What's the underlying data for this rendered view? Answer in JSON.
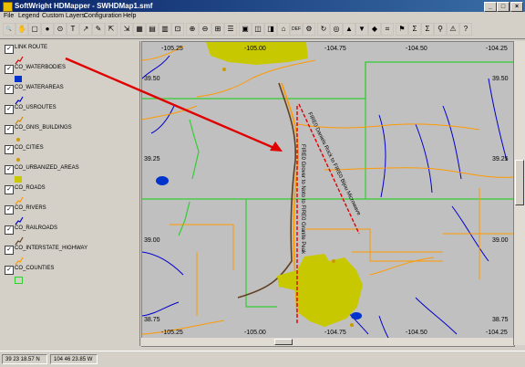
{
  "window": {
    "title": "SoftWright HDMapper - SWHDMap1.smf"
  },
  "menu": [
    "File",
    "Legend",
    "Custom Layers",
    "Configuration",
    "Help"
  ],
  "toolbar": {
    "count": 36
  },
  "legend": {
    "items": [
      {
        "label": "LINK ROUTE",
        "checked": true,
        "symbol": "line",
        "color": "#e00000"
      },
      {
        "label": "CO_WATERBODIES",
        "checked": true,
        "symbol": "fill",
        "color": "#0033cc"
      },
      {
        "label": "CO_WATERAREAS",
        "checked": true,
        "symbol": "line",
        "color": "#0000cc"
      },
      {
        "label": "CO_USROUTES",
        "checked": true,
        "symbol": "line",
        "color": "#cc8800"
      },
      {
        "label": "CO_GNIS_BUILDINGS",
        "checked": true,
        "symbol": "dot",
        "color": "#cc9900"
      },
      {
        "label": "CO_CITIES",
        "checked": true,
        "symbol": "dot",
        "color": "#cc9900"
      },
      {
        "label": "CO_URBANIZED_AREAS",
        "checked": true,
        "symbol": "fill",
        "color": "#c8c800"
      },
      {
        "label": "CO_ROADS",
        "checked": true,
        "symbol": "line",
        "color": "#ff9900"
      },
      {
        "label": "CO_RIVERS",
        "checked": true,
        "symbol": "line",
        "color": "#0000cc"
      },
      {
        "label": "CO_RAILROADS",
        "checked": true,
        "symbol": "line",
        "color": "#604020"
      },
      {
        "label": "CO_INTERSTATE_HIGHWAY",
        "checked": true,
        "symbol": "line",
        "color": "#ff9900"
      },
      {
        "label": "CO_COUNTIES",
        "checked": true,
        "symbol": "box",
        "color": "#33cc33"
      }
    ]
  },
  "map": {
    "top_longitudes": [
      "-105.25",
      "-105.00",
      "-104.75",
      "-104.50",
      "-104.25"
    ],
    "bottom_longitudes": [
      "-105.25",
      "-105.00",
      "-104.75",
      "-104.50",
      "-104.25"
    ],
    "left_latitudes": [
      "39.50",
      "39.25",
      "39.00",
      "38.75"
    ],
    "right_latitudes": [
      "39.50",
      "39.25",
      "39.00",
      "38.75"
    ],
    "route_label_1": "FIRE0 Daniels Rock to FIRE0 Bijou Microwave",
    "route_label_2": "FIRE0 Grover to Noto to FIRE0 Granite Peak",
    "colors": {
      "background": "#c0c0c0",
      "urban": "#c8c800",
      "county": "#33cc33",
      "road": "#ff9900",
      "river": "#0000cc",
      "route": "#e00000"
    }
  },
  "status": {
    "latitude": "39 23 18.57 N",
    "longitude": "104 46 23.85 W"
  }
}
